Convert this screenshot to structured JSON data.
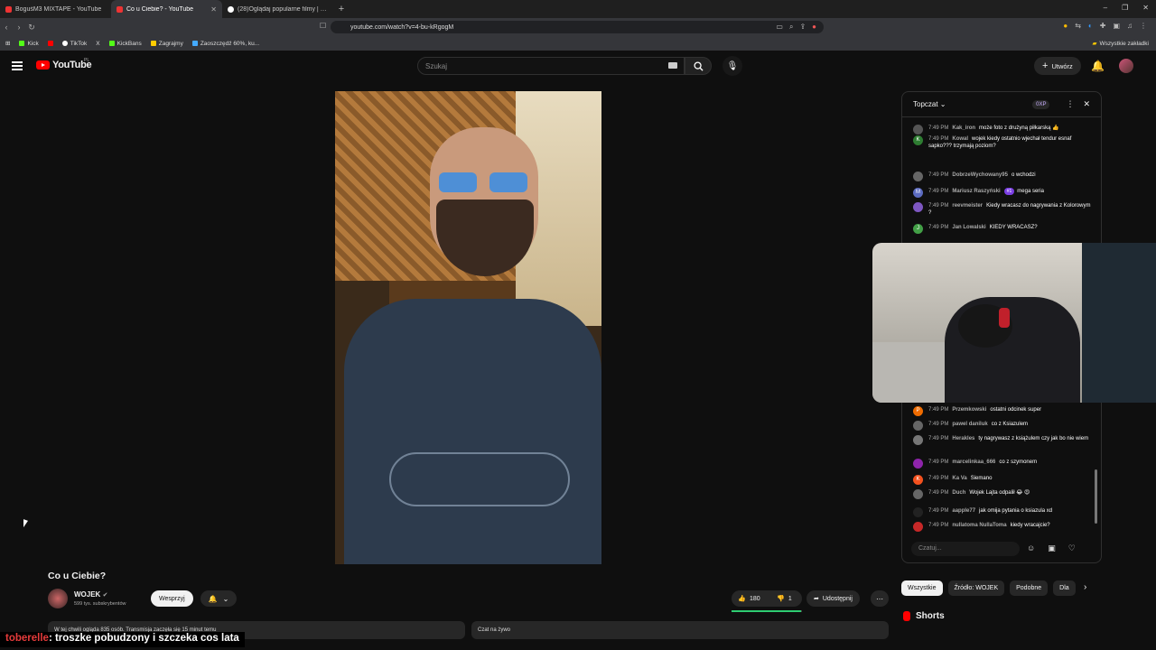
{
  "browser": {
    "tabs": [
      {
        "title": "BoguśM3 MIXTAPE - YouTube",
        "active": false
      },
      {
        "title": "Co u Ciebie? - YouTube",
        "active": true
      },
      {
        "title": "(28)Oglądaj popularne filmy | TikTok",
        "active": false
      }
    ],
    "url": "youtube.com/watch?v=4-bu-kRgogM",
    "bookmarks": [
      "Kick",
      "TikTok",
      "X",
      "KickBans",
      "Zagrajmy",
      "Zaoszczędź 60%, ku..."
    ],
    "all_bookmarks": "Wszystkie zakładki"
  },
  "header": {
    "logo": "YouTube",
    "region": "PL",
    "search_placeholder": "Szukaj",
    "create_label": "Utwórz"
  },
  "video": {
    "title": "Co u Ciebie?",
    "channel": "WOJEK",
    "subscribers": "599 tys. subskrybentów",
    "support_label": "Wesprzyj",
    "likes": "180",
    "dislikes": "1",
    "like_ratio": 0.99,
    "share_label": "Udostępnij",
    "description_peek": "W tej chwili ogląda 835 osób. Transmisja zaczęła się 15 minut temu",
    "chat_replay_peek": "Czat na żywo"
  },
  "chat": {
    "title": "Topczat",
    "xp": "0XP",
    "input_placeholder": "Czatuj...",
    "messages": [
      {
        "time": "7:49 PM",
        "author": "Kak_iron",
        "text": "może foto z drużyną piłkarską 👍",
        "color": "#555",
        "initial": ""
      },
      {
        "time": "7:49 PM",
        "author": "Kowal",
        "text": "wojek kiedy ostatnio wjechał tendur esnaf sapko??? trzymają poziom?",
        "color": "#2e7d32",
        "initial": "K"
      },
      {
        "time": "7:49 PM",
        "author": "DobrzeWychowany95",
        "text": "o wchodzi",
        "color": "#666",
        "initial": ""
      },
      {
        "time": "7:49 PM",
        "author": "Mariusz Raszyński",
        "text": "mega seria",
        "color": "#5c6bc0",
        "initial": "M",
        "badge": "#1"
      },
      {
        "time": "7:49 PM",
        "author": "reevmeister",
        "text": "Kiedy wracasz do nagrywania z Kolorowym ?",
        "color": "#7e57c2",
        "initial": ""
      },
      {
        "time": "7:49 PM",
        "author": "Jan Lowalski",
        "text": "KIEDY WRACASZ?",
        "color": "#43a047",
        "initial": "J"
      },
      {
        "time": "7:49 PM",
        "author": "Przemkowski",
        "text": "ostatni odcinek super",
        "color": "#ef6c00",
        "initial": "P"
      },
      {
        "time": "7:49 PM",
        "author": "pawel daniluk",
        "text": "co z Ksiazulem",
        "color": "#666",
        "initial": ""
      },
      {
        "time": "7:49 PM",
        "author": "Herakles",
        "text": "ty nagrywasz z książulem czy jak bo nie wiem",
        "color": "#777",
        "initial": ""
      },
      {
        "time": "7:49 PM",
        "author": "marcelinkaa_666",
        "text": "co z szymonem",
        "color": "#8e24aa",
        "initial": ""
      },
      {
        "time": "7:49 PM",
        "author": "Ka Va",
        "text": "Siemano",
        "color": "#f4511e",
        "initial": "K"
      },
      {
        "time": "7:49 PM",
        "author": "Duch",
        "text": "Wojek Lajta odpalił 😂 😍",
        "color": "#666",
        "initial": ""
      },
      {
        "time": "7:49 PM",
        "author": "aapple77",
        "text": "jak omija pytania o ksiazula xd",
        "color": "#222",
        "initial": ""
      },
      {
        "time": "7:49 PM",
        "author": "nullatoma NullaToma",
        "text": "kiedy wracajcie?",
        "color": "#c62828",
        "initial": ""
      }
    ]
  },
  "chips": [
    "Wszystkie",
    "Źródło: WOJEK",
    "Podobne",
    "Dla"
  ],
  "shorts_label": "Shorts",
  "overlay": {
    "user": "toberelle",
    "text": ": troszke pobudzony i szczeka cos lata"
  }
}
